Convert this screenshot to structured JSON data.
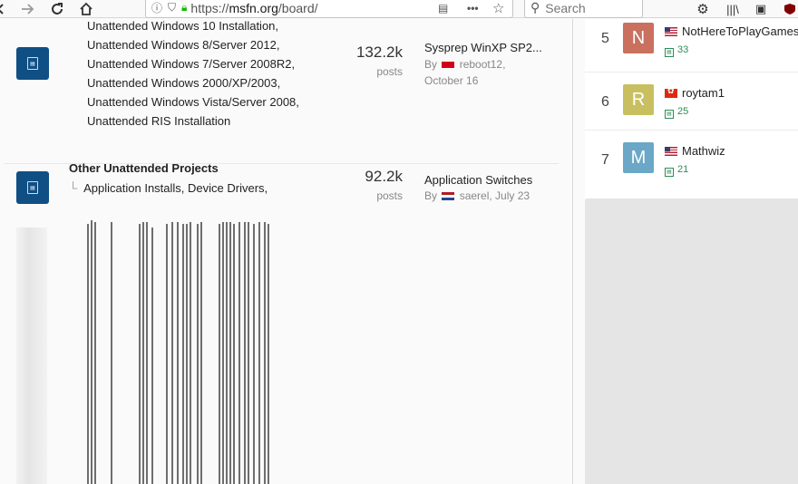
{
  "browser": {
    "url_prefix": "https://",
    "url_domain": "msfn.org",
    "url_path": "/board/",
    "search_placeholder": "Search"
  },
  "forums": [
    {
      "subforums": [
        "Unattended Windows 10 Installation,",
        "Unattended Windows 8/Server 2012,",
        "Unattended Windows 7/Server 2008R2,",
        "Unattended Windows 2000/XP/2003,",
        "Unattended Windows Vista/Server 2008,",
        "Unattended RIS Installation"
      ],
      "count": "132.2k",
      "count_unit": "posts",
      "last_post_title": "Sysprep WinXP SP2...",
      "by_label": "By",
      "last_post_user": "reboot12,",
      "last_post_date": "October 16"
    },
    {
      "title": "Other Unattended Projects",
      "subforums": [
        "Application Installs,",
        "Device Drivers,"
      ],
      "count": "92.2k",
      "count_unit": "posts",
      "last_post_title": "Application Switches",
      "by_label": "By",
      "last_post_user_date": "saerel, July 23"
    }
  ],
  "leaderboard": [
    {
      "rank": "5",
      "initial": "N",
      "avatar_color": "#c9705f",
      "name": "NotHereToPlayGames",
      "flag": "us",
      "rep": "33"
    },
    {
      "rank": "6",
      "initial": "R",
      "avatar_color": "#c8c060",
      "name": "roytam1",
      "flag": "hk",
      "rep": "25"
    },
    {
      "rank": "7",
      "initial": "M",
      "avatar_color": "#6ba7c6",
      "name": "Mathwiz",
      "flag": "us",
      "rep": "21"
    }
  ]
}
